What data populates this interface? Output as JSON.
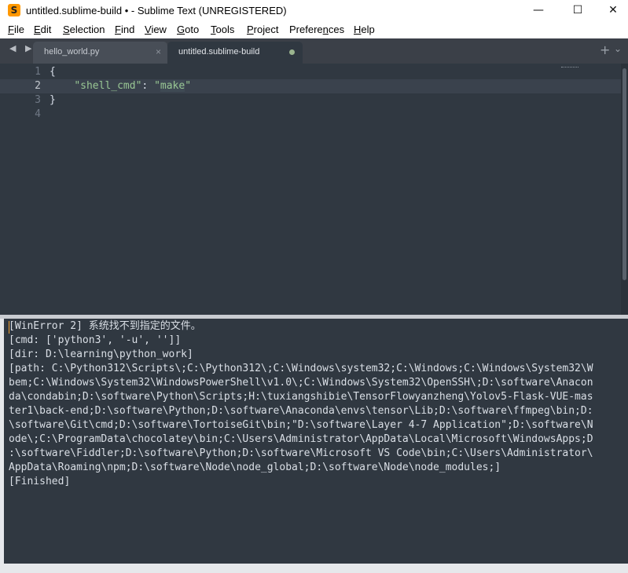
{
  "window": {
    "title": "untitled.sublime-build • - Sublime Text (UNREGISTERED)",
    "app_icon_letter": "S",
    "controls": {
      "minimize": "—",
      "maximize": "☐",
      "close": "✕"
    }
  },
  "menu": {
    "items": [
      {
        "label": "File",
        "underline": "F",
        "rest": "ile"
      },
      {
        "label": "Edit",
        "underline": "E",
        "rest": "dit"
      },
      {
        "label": "Selection",
        "underline": "S",
        "rest": "election"
      },
      {
        "label": "Find",
        "underline": "F",
        "rest": "ind"
      },
      {
        "label": "View",
        "underline": "V",
        "rest": "iew"
      },
      {
        "label": "Goto",
        "underline": "G",
        "rest": "oto"
      },
      {
        "label": "Tools",
        "underline": "T",
        "rest": "ools"
      },
      {
        "label": "Project",
        "underline": "P",
        "rest": "roject"
      },
      {
        "label": "Preferences",
        "underline": "n",
        "rest_before": "Prefere",
        "rest_after": "ces"
      },
      {
        "label": "Help",
        "underline": "H",
        "rest": "elp"
      }
    ]
  },
  "tabs": {
    "nav_arrows": "◀ ▶",
    "items": [
      {
        "label": "hello_world.py",
        "close": "×",
        "active": false
      },
      {
        "label": "untitled.sublime-build",
        "active": true,
        "dirty": true
      }
    ],
    "new_tab": "+",
    "overflow": "⌄"
  },
  "editor": {
    "line_numbers": [
      "1",
      "2",
      "3",
      "4"
    ],
    "lines": [
      "{",
      "    \"shell_cmd\": \"make\"",
      "}",
      ""
    ],
    "key": "\"shell_cmd\"",
    "colon": ": ",
    "value_open_quote": "\"",
    "value": "make",
    "value_close_quote": "\"",
    "open_brace": "{",
    "close_brace": "}"
  },
  "output": {
    "lines": [
      "[WinError 2] 系统找不到指定的文件。",
      "[cmd: ['python3', '-u', '']]",
      "[dir: D:\\learning\\python_work]",
      "[path: C:\\Python312\\Scripts\\;C:\\Python312\\;C:\\Windows\\system32;C:\\Windows;C:\\Windows\\System32\\W",
      "bem;C:\\Windows\\System32\\WindowsPowerShell\\v1.0\\;C:\\Windows\\System32\\OpenSSH\\;D:\\software\\Anacon",
      "da\\condabin;D:\\software\\Python\\Scripts;H:\\tuxiangshibie\\TensorFlowyanzheng\\Yolov5-Flask-VUE-mas",
      "ter1\\back-end;D:\\software\\Python;D:\\software\\Anaconda\\envs\\tensor\\Lib;D:\\software\\ffmpeg\\bin;D:",
      "\\software\\Git\\cmd;D:\\software\\TortoiseGit\\bin;\"D:\\software\\Layer 4-7 Application\";D:\\software\\N",
      "ode\\;C:\\ProgramData\\chocolatey\\bin;C:\\Users\\Administrator\\AppData\\Local\\Microsoft\\WindowsApps;D",
      ":\\software\\Fiddler;D:\\software\\Python;D:\\software\\Microsoft VS Code\\bin;C:\\Users\\Administrator\\",
      "AppData\\Roaming\\npm;D:\\software\\Node\\node_global;D:\\software\\Node\\node_modules;]",
      "[Finished]"
    ]
  },
  "colors": {
    "editor_bg": "#303841",
    "tab_bar_bg": "#3b4048",
    "string_green": "#99c794",
    "line_number": "#6f7885",
    "cursor_orange": "#f0a030"
  }
}
